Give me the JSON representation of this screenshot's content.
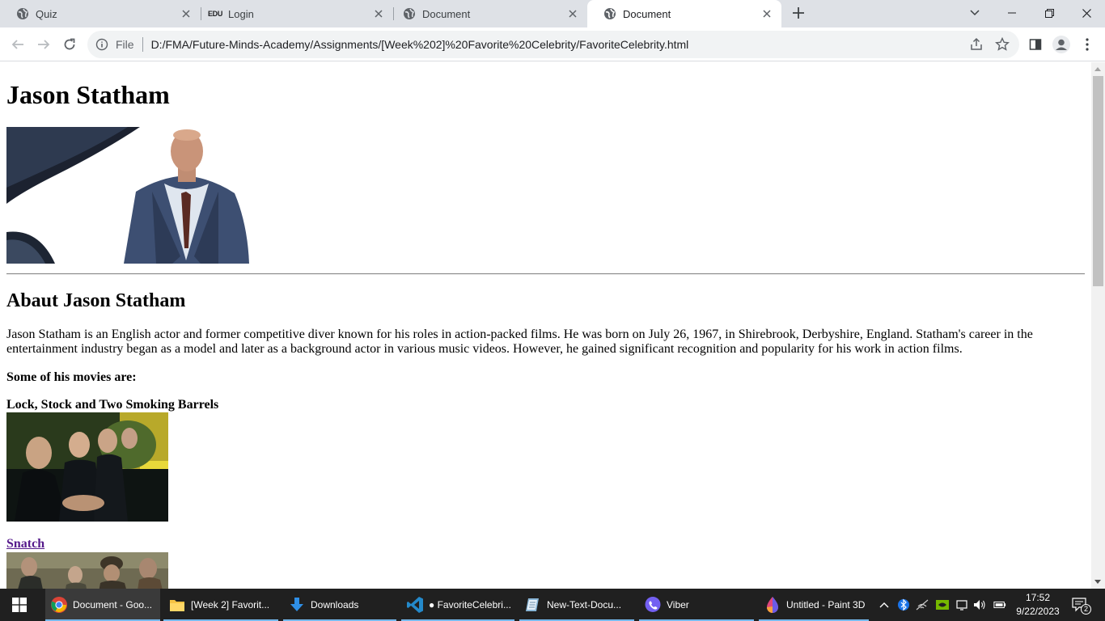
{
  "browser": {
    "tabs": [
      {
        "title": "Quiz",
        "icon": "globe-icon",
        "active": false
      },
      {
        "title": "Login",
        "icon": "edu-favicon",
        "icon_text": "EDU",
        "active": false
      },
      {
        "title": "Document",
        "icon": "globe-icon",
        "active": false
      },
      {
        "title": "Document",
        "icon": "globe-icon",
        "active": true
      }
    ],
    "address": {
      "scheme_label": "File",
      "url": "D:/FMA/Future-Minds-Academy/Assignments/[Week%202]%20Favorite%20Celebrity/FavoriteCelebrity.html"
    }
  },
  "page": {
    "heading": "Jason Statham",
    "about_heading": "Abaut Jason Statham",
    "about_text": "Jason Statham is an English actor and former competitive diver known for his roles in action-packed films. He was born on July 26, 1967, in Shirebrook, Derbyshire, England. Statham's career in the entertainment industry began as a model and later as a background actor in various music videos. However, he gained significant recognition and popularity for his work in action films.",
    "movies_heading": "Some of his movies are:",
    "movies": [
      {
        "title": "Lock, Stock and Two Smoking Barrels",
        "is_link": false
      },
      {
        "title": "Snatch",
        "is_link": true
      }
    ]
  },
  "taskbar": {
    "items": [
      {
        "label": "Document - Goo...",
        "icon": "chrome-icon",
        "active": true
      },
      {
        "label": "[Week 2] Favorit...",
        "icon": "folder-icon",
        "active": false
      },
      {
        "label": "Downloads",
        "icon": "download-icon",
        "active": false
      },
      {
        "label": "● FavoriteCelebri...",
        "icon": "vscode-icon",
        "active": false
      },
      {
        "label": "New-Text-Docu...",
        "icon": "notepad-icon",
        "active": false
      },
      {
        "label": "Viber",
        "icon": "viber-icon",
        "active": false
      },
      {
        "label": "Untitled - Paint 3D",
        "icon": "paint3d-icon",
        "active": false
      }
    ],
    "time": "17:52",
    "date": "9/22/2023",
    "notification_count": "2"
  },
  "colors": {
    "tabstrip": "#dee1e6",
    "link_visited": "#551a8b",
    "taskbar": "#202020",
    "taskbar_underline": "#76b9ed"
  }
}
